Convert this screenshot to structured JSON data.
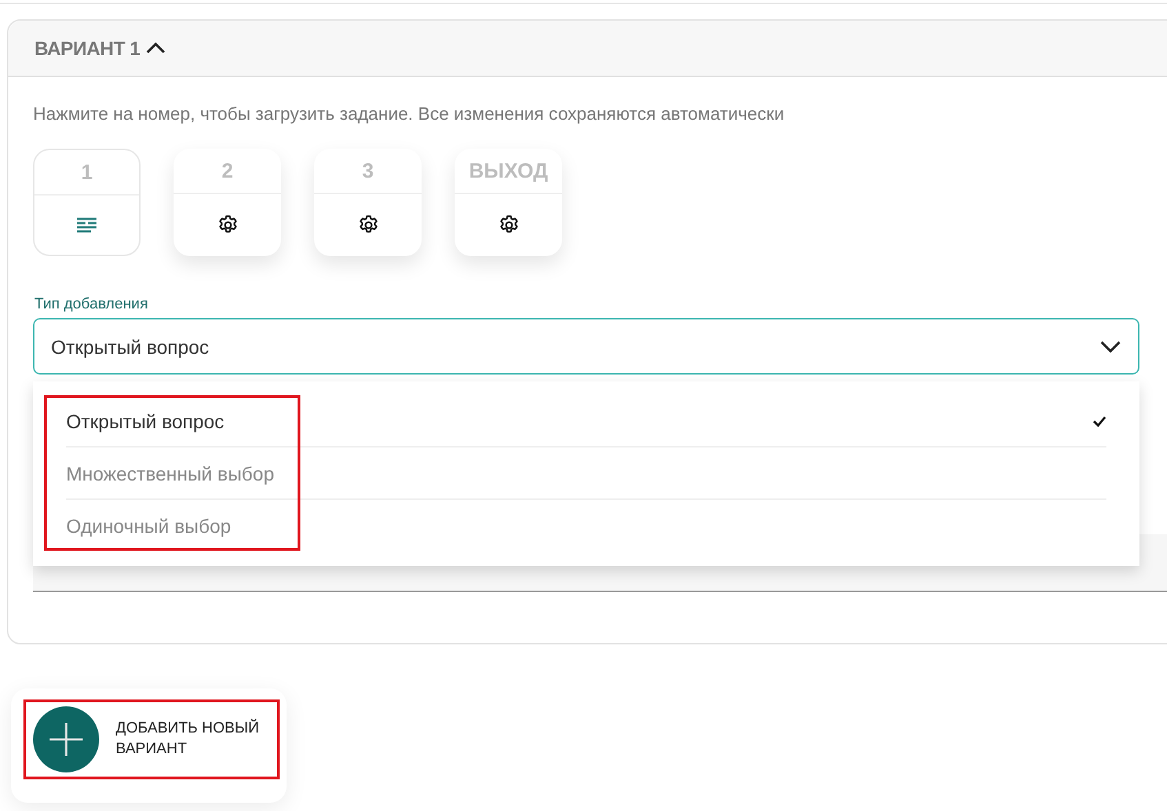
{
  "variant": {
    "title": "ВАРИАНТ 1",
    "expanded": true
  },
  "hint": "Нажмите на номер, чтобы загрузить задание. Все изменения сохраняются автоматически",
  "tasks": [
    {
      "label": "1",
      "kind": "text",
      "selected": true
    },
    {
      "label": "2",
      "kind": "settings",
      "selected": false
    },
    {
      "label": "3",
      "kind": "settings",
      "selected": false
    },
    {
      "label": "ВЫХОД",
      "kind": "settings",
      "selected": false
    }
  ],
  "type_select": {
    "label": "Тип добавления",
    "value": "Открытый вопрос",
    "open": true,
    "highlighted": true,
    "options": [
      {
        "label": "Открытый вопрос",
        "selected": true
      },
      {
        "label": "Множественный выбор",
        "selected": false
      },
      {
        "label": "Одиночный выбор",
        "selected": false
      }
    ]
  },
  "add_button": {
    "label": "ДОБАВИТЬ НОВЫЙ ВАРИАНТ",
    "highlighted": true
  }
}
